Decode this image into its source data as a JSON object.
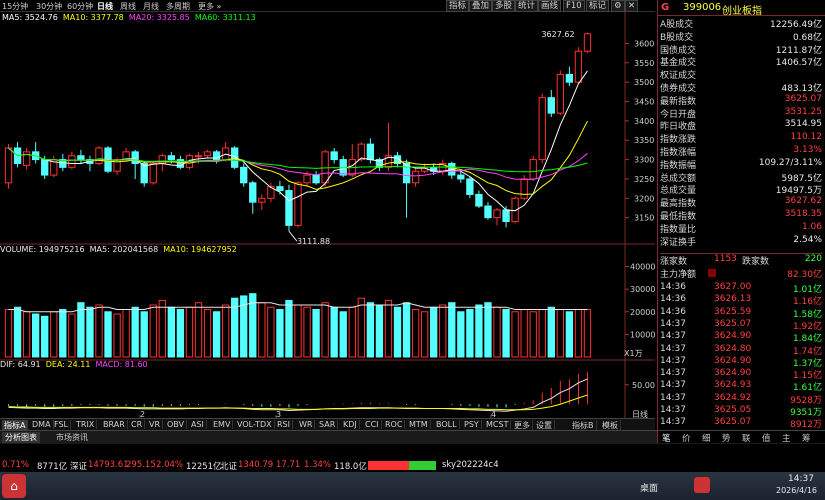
{
  "toolbar": {
    "periods": [
      "15分钟",
      "30分钟",
      "60分钟",
      "日线",
      "周线",
      "月线",
      "多周期",
      "更多"
    ],
    "selected_period": "日线",
    "right_buttons": [
      "指标",
      "叠加",
      "多股",
      "统计",
      "画线",
      "F10",
      "标记"
    ],
    "icons": [
      "gear-icon",
      "close-icon"
    ]
  },
  "ma_legend": {
    "ma5": "MA5: 3524.76",
    "ma10": "MA10: 3377.78",
    "ma20": "MA20: 3325.85",
    "ma60": "MA60: 3311.13",
    "colors": {
      "ma5": "#ffffff",
      "ma10": "#ffff00",
      "ma20": "#ff40ff",
      "ma60": "#00ff00"
    }
  },
  "price_axis": {
    "ticks": [
      "3600",
      "3550",
      "3500",
      "3450",
      "3400",
      "3350",
      "3300",
      "3250",
      "3200",
      "3150"
    ]
  },
  "annotations": {
    "high": "3627.62",
    "low": "3111.88"
  },
  "volume_legend": {
    "vol": "VOLUME: 194975216",
    "ma5": "MA5: 202041568",
    "ma10": "MA10: 194627952"
  },
  "volume_axis": {
    "ticks": [
      "40000",
      "30000",
      "20000",
      "10000"
    ],
    "unit": "X1万"
  },
  "macd_legend": {
    "dif": "DIF: 64.91",
    "dea": "DEA: 24.11",
    "macd": "MACD: 81.60"
  },
  "macd_axis": {
    "ticks": [
      "50.00"
    ]
  },
  "date_axis": {
    "labels": [
      "2",
      "3",
      "4"
    ],
    "right_label": "日线"
  },
  "indicator_tabs": [
    "指标A",
    "DMA",
    "FSL",
    "TRIX",
    "BRAR",
    "CR",
    "VR",
    "OBV",
    "ASI",
    "EMV",
    "VOL-TDX",
    "RSI",
    "WR",
    "SAR",
    "KDJ",
    "CCI",
    "ROC",
    "MTM",
    "BOLL",
    "PSY",
    "MCST",
    "更多",
    "设置"
  ],
  "indicator_right": [
    "指标B",
    "模板"
  ],
  "panel": {
    "code": "399006",
    "name": "创业板指",
    "marker": "G",
    "rows": [
      {
        "label": "A股成交",
        "value": "12256.49亿",
        "color": "wh"
      },
      {
        "label": "B股成交",
        "value": "0.68亿",
        "color": "wh"
      },
      {
        "label": "国债成交",
        "value": "1211.87亿",
        "color": "wh"
      },
      {
        "label": "基金成交",
        "value": "1406.57亿",
        "color": "wh"
      },
      {
        "label": "权证成交",
        "value": "",
        "color": "wh"
      },
      {
        "label": "债券成交",
        "value": "483.13亿",
        "color": "wh"
      },
      {
        "label": "最新指数",
        "value": "3625.07",
        "color": "up"
      },
      {
        "label": "今日开盘",
        "value": "3531.25",
        "color": "up"
      },
      {
        "label": "昨日收盘",
        "value": "3514.95",
        "color": "wh"
      },
      {
        "label": "指数涨跌",
        "value": "110.12",
        "color": "up"
      },
      {
        "label": "指数涨幅",
        "value": "3.13%",
        "color": "up"
      },
      {
        "label": "指数振幅",
        "value": "109.27/3.11%",
        "color": "wh"
      },
      {
        "label": "总成交额",
        "value": "5987.5亿",
        "color": "wh"
      },
      {
        "label": "总成交量",
        "value": "19497.5万",
        "color": "wh"
      },
      {
        "label": "最高指数",
        "value": "3627.62",
        "color": "up"
      },
      {
        "label": "最低指数",
        "value": "3518.35",
        "color": "up"
      },
      {
        "label": "指数量比",
        "value": "1.06",
        "color": "up"
      },
      {
        "label": "深证换手",
        "value": "2.54%",
        "color": "wh"
      }
    ],
    "updown": {
      "up_label": "涨家数",
      "up": "1153",
      "down_label": "跌家数",
      "down": "220"
    },
    "net": {
      "label": "主力净额",
      "value": "82.30亿"
    },
    "ticks": [
      {
        "time": "14:36",
        "price": "3627.00",
        "vol": "1.01亿"
      },
      {
        "time": "14:36",
        "price": "3626.13",
        "vol": "1.16亿"
      },
      {
        "time": "14:36",
        "price": "3625.59",
        "vol": "1.58亿"
      },
      {
        "time": "14:37",
        "price": "3625.07",
        "vol": "1.92亿"
      },
      {
        "time": "14:37",
        "price": "3624.90",
        "vol": "1.84亿"
      },
      {
        "time": "14:37",
        "price": "3624.80",
        "vol": "1.74亿"
      },
      {
        "time": "14:37",
        "price": "3624.90",
        "vol": "1.37亿"
      },
      {
        "time": "14:37",
        "price": "3624.90",
        "vol": "1.15亿"
      },
      {
        "time": "14:37",
        "price": "3624.93",
        "vol": "1.61亿"
      },
      {
        "time": "14:37",
        "price": "3624.92",
        "vol": "9528万"
      },
      {
        "time": "14:37",
        "price": "3625.05",
        "vol": "9351万"
      },
      {
        "time": "14:37",
        "price": "3625.07",
        "vol": "8912万"
      }
    ],
    "bottom_tabs": [
      "笔",
      "价",
      "细",
      "势",
      "联",
      "值",
      "主",
      "筹"
    ]
  },
  "bottom_bar": {
    "tabs": [
      "分析图表",
      "市场资讯"
    ]
  },
  "status": {
    "seg1": "0.71%",
    "seg1b": "8771亿",
    "sz_label": "深证",
    "sz_val": "14793.61",
    "sz_chg": "295.15",
    "sz_pct": "2.04%",
    "sz_amt": "12251亿",
    "bz_label": "北证",
    "bz_val": "1340.79",
    "bz_chg": "17.71",
    "bz_pct": "1.34%",
    "bz_amt": "118.0亿",
    "user": "sky202224c4"
  },
  "taskbar": {
    "desktop": "桌面",
    "time": "14:37",
    "date": "2026/4/16"
  },
  "chart_data": {
    "type": "candlestick",
    "price_range": [
      3100,
      3640
    ],
    "candles": [
      [
        3240,
        3330,
        3225,
        3340
      ],
      [
        3330,
        3290,
        3280,
        3345
      ],
      [
        3285,
        3320,
        3275,
        3330
      ],
      [
        3320,
        3300,
        3290,
        3345
      ],
      [
        3300,
        3260,
        3250,
        3310
      ],
      [
        3260,
        3300,
        3255,
        3310
      ],
      [
        3300,
        3280,
        3270,
        3315
      ],
      [
        3280,
        3310,
        3275,
        3320
      ],
      [
        3310,
        3300,
        3290,
        3325
      ],
      [
        3300,
        3290,
        3270,
        3310
      ],
      [
        3290,
        3330,
        3285,
        3335
      ],
      [
        3330,
        3270,
        3265,
        3335
      ],
      [
        3270,
        3300,
        3260,
        3305
      ],
      [
        3300,
        3320,
        3295,
        3330
      ],
      [
        3320,
        3290,
        3250,
        3325
      ],
      [
        3290,
        3240,
        3230,
        3295
      ],
      [
        3240,
        3290,
        3235,
        3295
      ],
      [
        3290,
        3310,
        3270,
        3315
      ],
      [
        3310,
        3300,
        3290,
        3320
      ],
      [
        3300,
        3280,
        3275,
        3310
      ],
      [
        3280,
        3310,
        3275,
        3315
      ],
      [
        3310,
        3310,
        3290,
        3320
      ],
      [
        3310,
        3320,
        3305,
        3325
      ],
      [
        3320,
        3300,
        3290,
        3325
      ],
      [
        3300,
        3330,
        3295,
        3345
      ],
      [
        3330,
        3280,
        3275,
        3335
      ],
      [
        3280,
        3240,
        3230,
        3290
      ],
      [
        3240,
        3190,
        3160,
        3245
      ],
      [
        3190,
        3200,
        3170,
        3210
      ],
      [
        3200,
        3230,
        3190,
        3240
      ],
      [
        3230,
        3220,
        3210,
        3245
      ],
      [
        3220,
        3130,
        3115,
        3235
      ],
      [
        3130,
        3240,
        3125,
        3245
      ],
      [
        3240,
        3260,
        3230,
        3270
      ],
      [
        3260,
        3240,
        3235,
        3270
      ],
      [
        3240,
        3320,
        3230,
        3325
      ],
      [
        3320,
        3300,
        3290,
        3330
      ],
      [
        3300,
        3260,
        3255,
        3310
      ],
      [
        3260,
        3300,
        3255,
        3340
      ],
      [
        3300,
        3340,
        3295,
        3345
      ],
      [
        3340,
        3300,
        3290,
        3355
      ],
      [
        3300,
        3280,
        3270,
        3305
      ],
      [
        3280,
        3310,
        3270,
        3395
      ],
      [
        3310,
        3290,
        3280,
        3320
      ],
      [
        3290,
        3240,
        3150,
        3300
      ],
      [
        3240,
        3270,
        3230,
        3280
      ],
      [
        3270,
        3280,
        3265,
        3290
      ],
      [
        3280,
        3270,
        3260,
        3290
      ],
      [
        3270,
        3290,
        3260,
        3300
      ],
      [
        3290,
        3260,
        3250,
        3295
      ],
      [
        3260,
        3250,
        3240,
        3275
      ],
      [
        3250,
        3210,
        3200,
        3255
      ],
      [
        3210,
        3180,
        3175,
        3220
      ],
      [
        3180,
        3150,
        3145,
        3190
      ],
      [
        3150,
        3170,
        3130,
        3175
      ],
      [
        3170,
        3140,
        3125,
        3180
      ],
      [
        3140,
        3200,
        3135,
        3205
      ],
      [
        3200,
        3250,
        3195,
        3260
      ],
      [
        3250,
        3300,
        3245,
        3310
      ],
      [
        3300,
        3460,
        3290,
        3470
      ],
      [
        3460,
        3420,
        3410,
        3480
      ],
      [
        3420,
        3520,
        3415,
        3530
      ],
      [
        3520,
        3500,
        3490,
        3540
      ],
      [
        3500,
        3580,
        3495,
        3590
      ],
      [
        3580,
        3625,
        3575,
        3628
      ]
    ],
    "volume": [
      21,
      22,
      20,
      19,
      18,
      20,
      21,
      19,
      24,
      22,
      23,
      20,
      19,
      21,
      22,
      20,
      23,
      25,
      22,
      21,
      22,
      24,
      21,
      20,
      23,
      26,
      27,
      28,
      24,
      22,
      21,
      25,
      23,
      22,
      21,
      24,
      22,
      20,
      22,
      26,
      24,
      23,
      25,
      22,
      24,
      21,
      20,
      22,
      23,
      24,
      20,
      21,
      23,
      24,
      22,
      21,
      20,
      21,
      20,
      21,
      22,
      21,
      20,
      21,
      21
    ],
    "volume_ma5": [
      21,
      21,
      20,
      20,
      20,
      20,
      20,
      20,
      21,
      21,
      22,
      22,
      21,
      21,
      21,
      21,
      22,
      22,
      22,
      22,
      22,
      22,
      22,
      22,
      22,
      22,
      23,
      24,
      24,
      24,
      23,
      23,
      23,
      23,
      23,
      23,
      22,
      22,
      22,
      23,
      23,
      23,
      23,
      23,
      24,
      23,
      22,
      22,
      22,
      22,
      22,
      22,
      22,
      22,
      22,
      22,
      21,
      21,
      21,
      21,
      21,
      21,
      21,
      21,
      21
    ],
    "macd_dif": [
      -8,
      -9,
      -10,
      -10,
      -11,
      -11,
      -10,
      -10,
      -9,
      -9,
      -9,
      -10,
      -10,
      -10,
      -11,
      -12,
      -12,
      -12,
      -12,
      -12,
      -11,
      -11,
      -10,
      -10,
      -9,
      -10,
      -11,
      -13,
      -14,
      -14,
      -14,
      -16,
      -15,
      -14,
      -13,
      -12,
      -11,
      -11,
      -10,
      -9,
      -9,
      -9,
      -9,
      -10,
      -11,
      -11,
      -11,
      -11,
      -11,
      -12,
      -13,
      -14,
      -15,
      -16,
      -17,
      -18,
      -15,
      -12,
      -8,
      5,
      15,
      30,
      40,
      55,
      65
    ],
    "macd_dea": [
      -6,
      -7,
      -7,
      -8,
      -8,
      -8,
      -8,
      -8,
      -8,
      -8,
      -8,
      -8,
      -8,
      -8,
      -9,
      -9,
      -9,
      -10,
      -10,
      -10,
      -10,
      -10,
      -10,
      -10,
      -10,
      -10,
      -10,
      -11,
      -11,
      -11,
      -12,
      -12,
      -13,
      -13,
      -13,
      -12,
      -12,
      -12,
      -11,
      -11,
      -11,
      -10,
      -10,
      -10,
      -10,
      -10,
      -11,
      -11,
      -11,
      -11,
      -11,
      -12,
      -12,
      -13,
      -13,
      -14,
      -14,
      -14,
      -13,
      -10,
      -6,
      0,
      8,
      16,
      24
    ]
  }
}
